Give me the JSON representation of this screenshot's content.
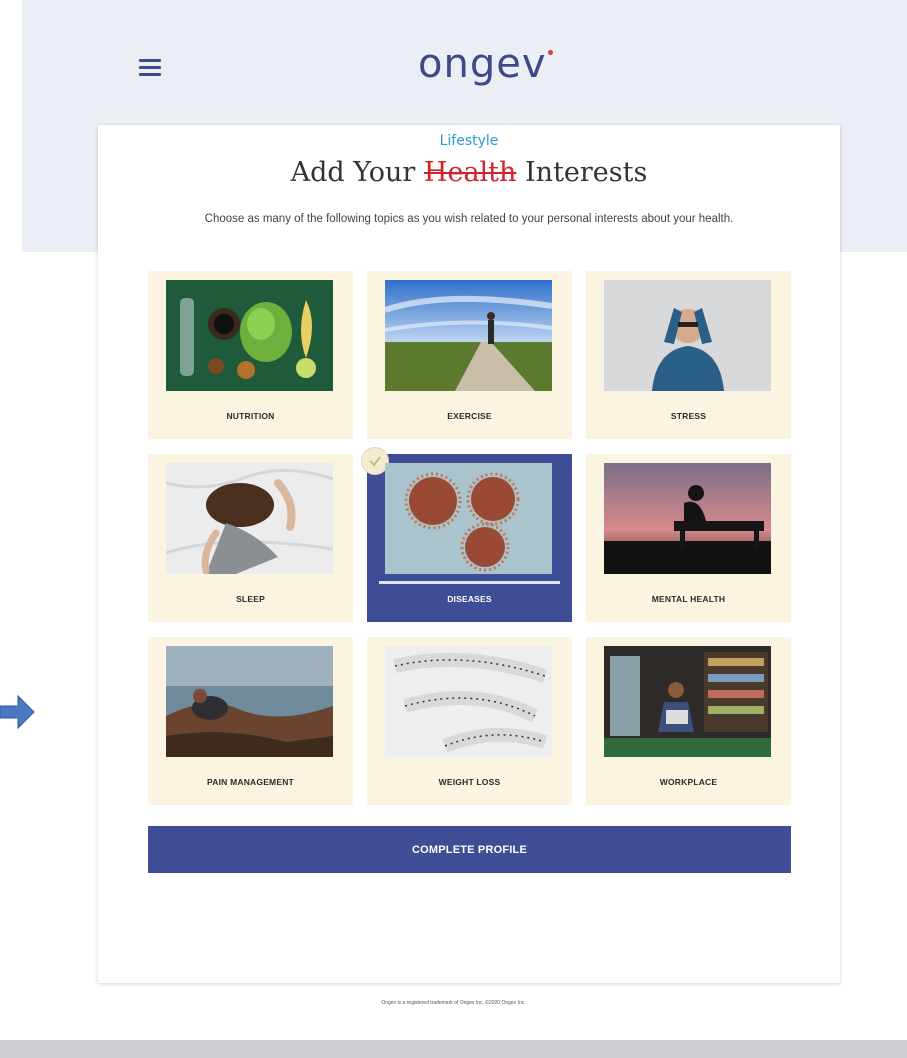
{
  "header": {
    "logo_text": "ongev",
    "menu_icon": "hamburger-menu-icon"
  },
  "page": {
    "kicker": "Lifestyle",
    "title_prefix": "Add Your",
    "title_struck": "Health",
    "title_suffix": "Interests",
    "subtitle": "Choose as many of the following topics as you wish related to your personal interests about your health."
  },
  "topics": [
    {
      "label": "NUTRITION",
      "selected": false
    },
    {
      "label": "EXERCISE",
      "selected": false
    },
    {
      "label": "STRESS",
      "selected": false
    },
    {
      "label": "SLEEP",
      "selected": false
    },
    {
      "label": "DISEASES",
      "selected": true
    },
    {
      "label": "MENTAL HEALTH",
      "selected": false
    },
    {
      "label": "PAIN MANAGEMENT",
      "selected": false
    },
    {
      "label": "WEIGHT LOSS",
      "selected": false
    },
    {
      "label": "WORKPLACE",
      "selected": false
    }
  ],
  "cta": {
    "label": "COMPLETE PROFILE"
  },
  "footer": {
    "note": "Ongev is a registered trademark of Ongev Inc. ©2020 Ongev Inc."
  },
  "colors": {
    "brand": "#3e4d96",
    "tile_bg": "#faf4e1",
    "kicker": "#2e9ad6",
    "strike": "#d2232a"
  }
}
